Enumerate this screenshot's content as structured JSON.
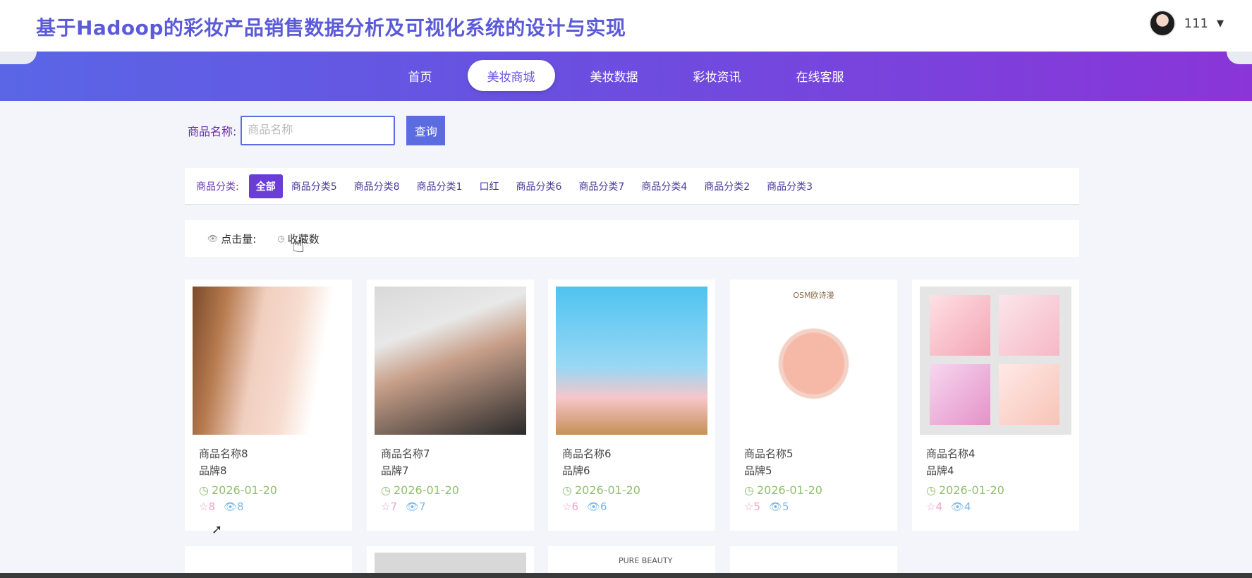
{
  "header": {
    "title": "基于Hadoop的彩妆产品销售数据分析及可视化系统的设计与实现",
    "user": {
      "name": "111",
      "avatar_icon": "user-avatar",
      "caret_icon": "caret-down-icon"
    }
  },
  "nav": {
    "items": [
      {
        "label": "首页",
        "active": false
      },
      {
        "label": "美妆商城",
        "active": true
      },
      {
        "label": "美妆数据",
        "active": false
      },
      {
        "label": "彩妆资讯",
        "active": false
      },
      {
        "label": "在线客服",
        "active": false
      }
    ]
  },
  "search": {
    "label": "商品名称:",
    "placeholder": "商品名称",
    "value": "",
    "button_label": "查询"
  },
  "categories": {
    "label": "商品分类:",
    "items": [
      "全部",
      "商品分类5",
      "商品分类8",
      "商品分类1",
      "口红",
      "商品分类6",
      "商品分类7",
      "商品分类4",
      "商品分类2",
      "商品分类3"
    ],
    "active_index": 0
  },
  "sort": {
    "items": [
      {
        "label": "点击量:",
        "icon": "eye-icon"
      },
      {
        "label": "收藏数",
        "icon": "clock-icon"
      }
    ]
  },
  "products": [
    {
      "name": "商品名称8",
      "brand": "品牌8",
      "date": "2026-01-20",
      "favorites": "8",
      "views": "8",
      "image": "woman-profile"
    },
    {
      "name": "商品名称7",
      "brand": "品牌7",
      "date": "2026-01-20",
      "favorites": "7",
      "views": "7",
      "image": "woman-lashes"
    },
    {
      "name": "商品名称6",
      "brand": "品牌6",
      "date": "2026-01-20",
      "favorites": "6",
      "views": "6",
      "image": "cartoon-girl"
    },
    {
      "name": "商品名称5",
      "brand": "品牌5",
      "date": "2026-01-20",
      "favorites": "5",
      "views": "5",
      "image": "osm-cream-jar",
      "image_text": "OSM欧诗漫"
    },
    {
      "name": "商品名称4",
      "brand": "品牌4",
      "date": "2026-01-20",
      "favorites": "4",
      "views": "4",
      "image": "cosmetics-collage"
    }
  ],
  "partial_row": {
    "image_text": "PURE BEAUTY"
  },
  "colors": {
    "accent": "#5b6be0",
    "nav_gradient_start": "#5a66e6",
    "nav_gradient_end": "#8a35d8",
    "date_green": "#8fbf6f",
    "fav_pink": "#f2a3c8",
    "view_blue": "#7ab7e8"
  }
}
